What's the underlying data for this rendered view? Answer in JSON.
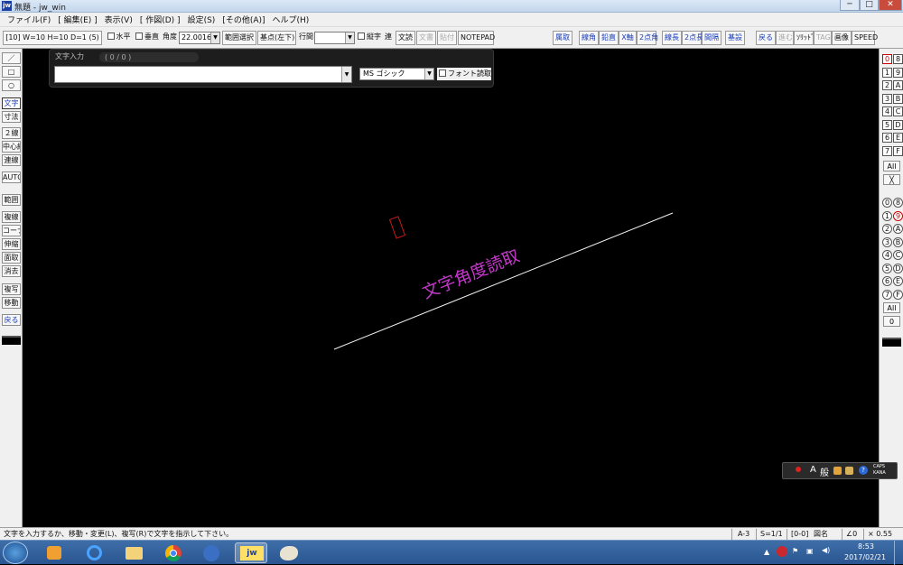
{
  "window": {
    "title": "無題 - jw_win",
    "app_icon": "jw",
    "controls": {
      "minimize": "─",
      "maximize": "□",
      "close": "✕"
    }
  },
  "menu": [
    "ファイル(F)",
    "[ 編集(E) ]",
    "表示(V)",
    "[ 作図(D) ]",
    "設定(S)",
    "[その他(A)]",
    "ヘルプ(H)"
  ],
  "toolbar": {
    "font_info": "[10]  W=10 H=10 D=1 (5)",
    "horizontal": "水平",
    "vertical": "垂直",
    "angle_label": "角度",
    "angle_value": "22.0016°",
    "range_select": "範囲選択",
    "base_point": "基点(左下)",
    "line_spacing": "行間",
    "line_spacing_value": "",
    "tate": "縦字",
    "ren": "連",
    "moji_retsu": "文読",
    "moji_kaki": "文書",
    "paste": "貼付",
    "notepad": "NOTEPAD",
    "right_buttons": [
      "属取",
      "線角",
      "鉛直",
      "X軸",
      "2点角",
      "線長",
      "2点長",
      "間隔",
      "基設",
      "戻る",
      "進む",
      "ｿﾘｯﾄﾞ",
      "TAG",
      "画像",
      "SPEED"
    ]
  },
  "left_tools": [
    "／",
    "□",
    "○",
    "文字",
    "寸法",
    "２線",
    "中心線",
    "連線",
    "AUTO",
    "範囲",
    "複線",
    "コーナー",
    "伸縮",
    "面取",
    "消去",
    "複写",
    "移動",
    "戻る"
  ],
  "right_layers": {
    "group_a": [
      "0",
      "8",
      "1",
      "9",
      "2",
      "A",
      "3",
      "B",
      "4",
      "C",
      "5",
      "D",
      "6",
      "E",
      "7",
      "F"
    ],
    "all": "All",
    "cross": "╳",
    "group_b": [
      "0",
      "8",
      "1",
      "9",
      "2",
      "A",
      "3",
      "B",
      "4",
      "C",
      "5",
      "D",
      "6",
      "E",
      "7",
      "F"
    ],
    "all2": "All",
    "zero": "0"
  },
  "text_panel": {
    "title": "文字入力",
    "count": "( 0 /   0 )",
    "input_value": "",
    "font": "MS ゴシック",
    "font_read": "フォント読取"
  },
  "canvas_text": "文字角度読取",
  "colors": {
    "canvas": "#000000",
    "line": "#f2f2f2",
    "text": "#c238c8",
    "cursor": "#c41a1a"
  },
  "ime": {
    "mode": "A",
    "label": "般",
    "caps": "CAPS",
    "kana": "KANA"
  },
  "status": {
    "message": "文字を入力するか、移動・変更(L)、複写(R)で文字を指示して下さい。",
    "paper": "A-3",
    "scale": "S=1/1",
    "layer": "[0-0]",
    "figure": "図名",
    "angle": "∠0",
    "zoom": "× 0.55"
  },
  "tray": {
    "time": "8:53",
    "date": "2017/02/21"
  }
}
